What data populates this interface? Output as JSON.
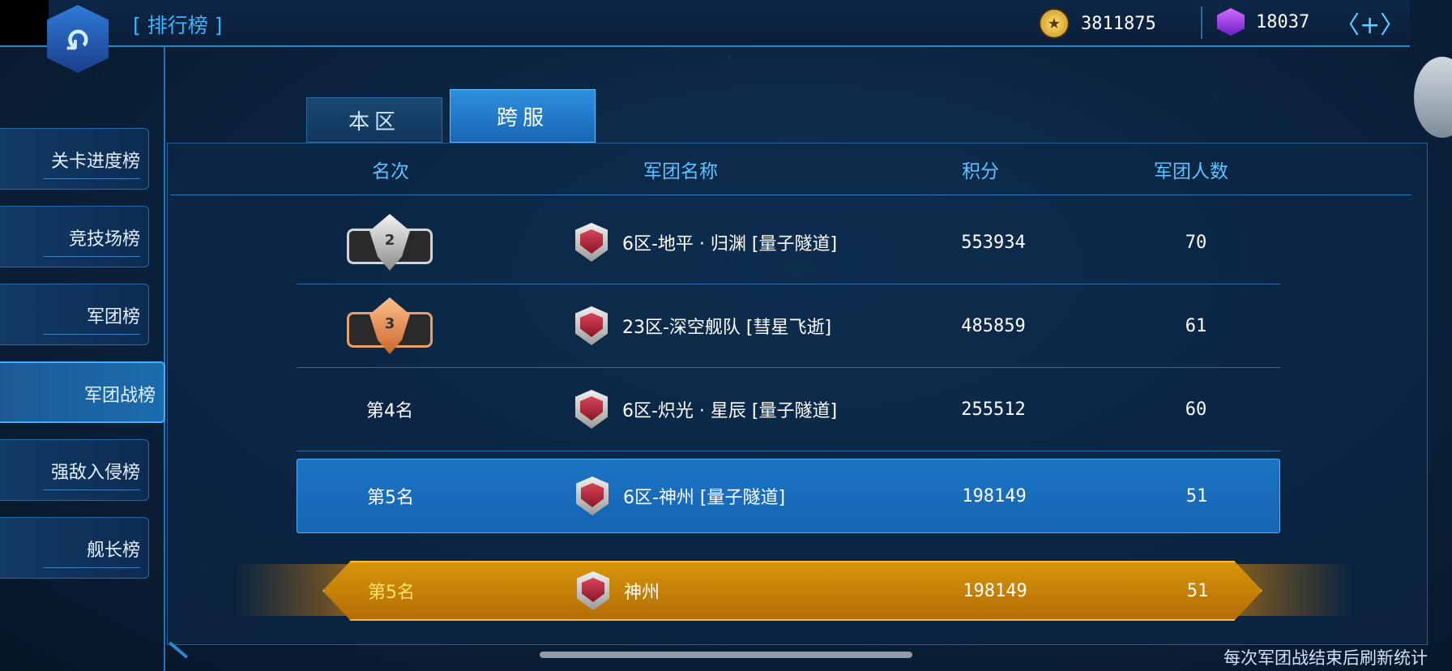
{
  "header": {
    "title": "[ 排行榜 ]",
    "gold": "3811875",
    "gems": "18037",
    "add_icon": "plus-icon"
  },
  "sidebar": {
    "items": [
      {
        "label": "关卡进度榜"
      },
      {
        "label": "竞技场榜"
      },
      {
        "label": "军团榜"
      },
      {
        "label": "军团战榜"
      },
      {
        "label": "强敌入侵榜"
      },
      {
        "label": "舰长榜"
      }
    ],
    "active_index": 3
  },
  "tabs": [
    {
      "label": "本区"
    },
    {
      "label": "跨服"
    }
  ],
  "active_tab": 1,
  "columns": {
    "rank": "名次",
    "name": "军团名称",
    "score": "积分",
    "count": "军团人数"
  },
  "rows": [
    {
      "rank": "",
      "medal": "2",
      "name": "6区-地平 · 归渊 [量子隧道]",
      "score": "553934",
      "count": "70"
    },
    {
      "rank": "",
      "medal": "3",
      "name": "23区-深空舰队 [彗星飞逝]",
      "score": "485859",
      "count": "61"
    },
    {
      "rank": "第4名",
      "name": "6区-炽光 · 星辰 [量子隧道]",
      "score": "255512",
      "count": "60"
    },
    {
      "rank": "第5名",
      "name": "6区-神州 [量子隧道]",
      "score": "198149",
      "count": "51"
    }
  ],
  "own": {
    "rank": "第5名",
    "name": "神州",
    "score": "198149",
    "count": "51"
  },
  "footer": "每次军团战结束后刷新统计",
  "colors": {
    "accent": "#38b6ff",
    "selected_row": "#1d74c4",
    "own_row": "#d8950a"
  }
}
